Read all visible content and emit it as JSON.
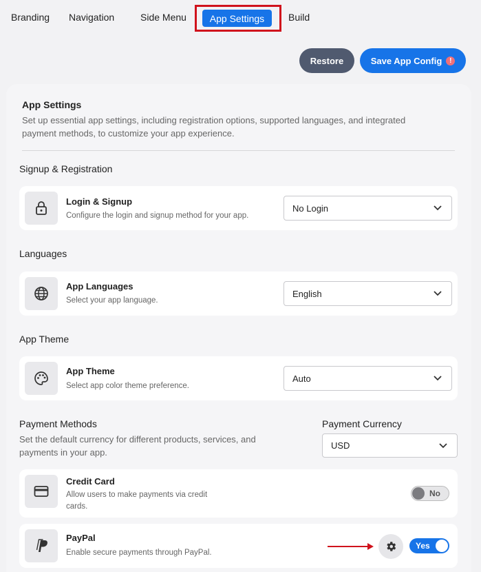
{
  "tabs": {
    "branding": "Branding",
    "navigation": "Navigation",
    "side_menu": "Side Menu",
    "app_settings": "App Settings",
    "build": "Build"
  },
  "actions": {
    "restore": "Restore",
    "save": "Save App Config",
    "save_badge": "!"
  },
  "header": {
    "title": "App Settings",
    "description_line1": "Set up essential app settings, including registration options, supported languages, and integrated",
    "description_line2": "payment methods, to customize your app experience."
  },
  "signup": {
    "section_title": "Signup & Registration",
    "title": "Login & Signup",
    "description": "Configure the login and signup method for your app.",
    "selected": "No Login",
    "icon": "lock-icon"
  },
  "languages": {
    "section_title": "Languages",
    "title": "App Languages",
    "description": "Select your app language.",
    "selected": "English",
    "icon": "globe-icon"
  },
  "theme": {
    "section_title": "App Theme",
    "title": "App Theme",
    "description": "Select app color theme preference.",
    "selected": "Auto",
    "icon": "palette-icon"
  },
  "payments": {
    "section_title": "Payment Methods",
    "description_line1": "Set the default currency for different products, services, and",
    "description_line2": "payments in your app.",
    "currency_label": "Payment Currency",
    "currency_selected": "USD",
    "credit_card": {
      "title": "Credit Card",
      "description_line1": "Allow users to make payments via credit",
      "description_line2": "cards.",
      "toggle": "No",
      "enabled": false,
      "icon": "credit-card-icon"
    },
    "paypal": {
      "title": "PayPal",
      "description": "Enable secure payments through PayPal.",
      "toggle": "Yes",
      "enabled": true,
      "icon": "paypal-icon"
    }
  },
  "colors": {
    "accent": "#1774e8",
    "highlight_frame": "#d0121c",
    "arrow": "#d0121c",
    "restore": "#505a6f"
  }
}
